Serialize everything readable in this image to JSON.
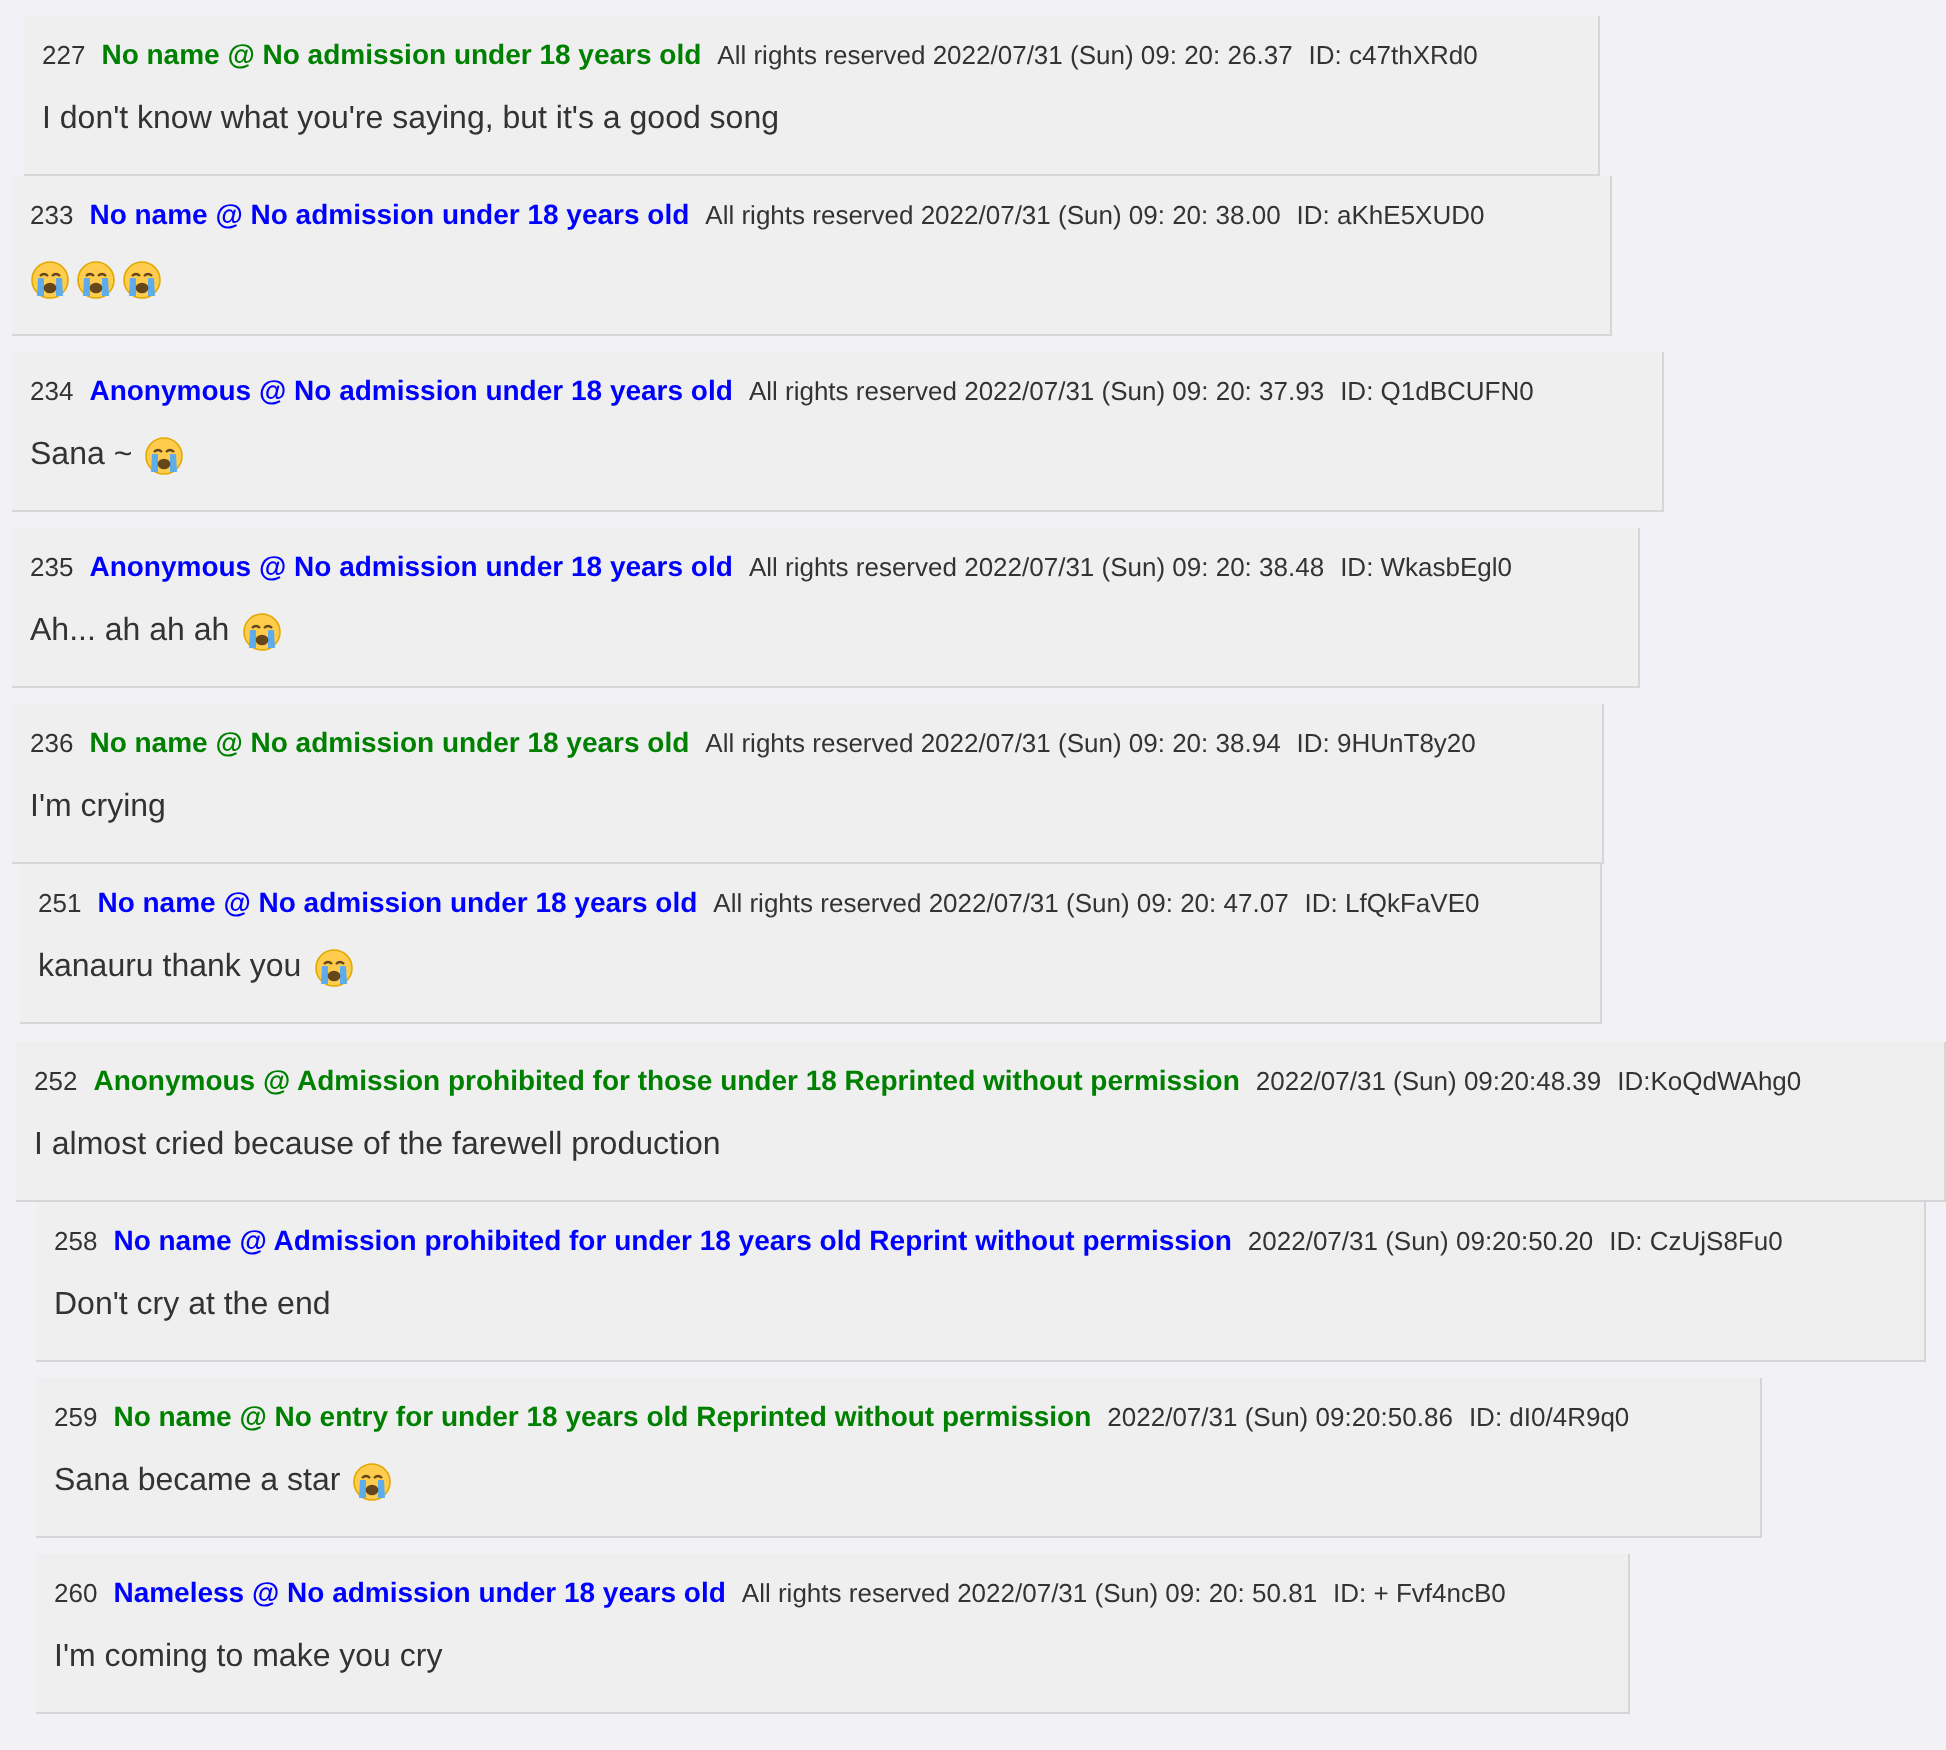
{
  "posts": [
    {
      "number": "227",
      "name": "No name @ No admission under 18 years old",
      "color": "#008000",
      "date": "All rights reserved 2022/07/31 (Sun) 09: 20: 26.37",
      "id": "ID: c47thXRd0",
      "body": "I don't know what you're saying, but it's a good song"
    },
    {
      "number": "233",
      "name": "No name @ No admission under 18 years old",
      "color": "#0000ff",
      "date": "All rights reserved 2022/07/31 (Sun) 09: 20: 38.00",
      "id": "ID: aKhE5XUD0",
      "emojis": [
        {
          "kind": "crying"
        },
        {
          "kind": "crying"
        },
        {
          "kind": "crying"
        }
      ]
    },
    {
      "number": "234",
      "name": "Anonymous @ No admission under 18 years old",
      "color": "#0000ff",
      "date": "All rights reserved 2022/07/31 (Sun) 09: 20: 37.93",
      "id": "ID: Q1dBCUFN0",
      "body": "Sana ~",
      "emojis": [
        {
          "kind": "crying"
        }
      ]
    },
    {
      "number": "235",
      "name": "Anonymous @ No admission under 18 years old",
      "color": "#0000ff",
      "date": "All rights reserved 2022/07/31 (Sun) 09: 20: 38.48",
      "id": "ID: WkasbEgl0",
      "body": "Ah... ah ah ah",
      "emojis": [
        {
          "kind": "crying"
        }
      ]
    },
    {
      "number": "236",
      "name": "No name @ No admission under 18 years old",
      "color": "#008000",
      "date": "All rights reserved 2022/07/31 (Sun) 09: 20: 38.94",
      "id": "ID: 9HUnT8y20",
      "body": "I'm crying"
    },
    {
      "number": "251",
      "name": "No name @ No admission under 18 years old",
      "color": "#0000ff",
      "date": "All rights reserved 2022/07/31 (Sun) 09: 20: 47.07",
      "id": "ID: LfQkFaVE0",
      "body": "kanauru thank you",
      "emojis": [
        {
          "kind": "crying"
        }
      ]
    },
    {
      "number": "252",
      "name": "Anonymous @ Admission prohibited for those under 18 Reprinted without permission",
      "color": "#008000",
      "date": "2022/07/31 (Sun) 09:20:48.39",
      "id": "ID:KoQdWAhg0",
      "body": "I almost cried because of the farewell production"
    },
    {
      "number": "258",
      "name": "No name @ Admission prohibited for under 18 years old Reprint without permission",
      "color": "#0000ff",
      "date": "2022/07/31 (Sun) 09:20:50.20",
      "id": "ID: CzUjS8Fu0",
      "body": "Don't cry at the end"
    },
    {
      "number": "259",
      "name": "No name @ No entry for under 18 years old Reprinted without permission",
      "color": "#008000",
      "date": "2022/07/31 (Sun) 09:20:50.86",
      "id": "ID: dI0/4R9q0",
      "body": "Sana became a star",
      "emojis": [
        {
          "kind": "crying"
        }
      ]
    },
    {
      "number": "260",
      "name": "Nameless @ No admission under 18 years old",
      "color": "#0000ff",
      "date": "All rights reserved 2022/07/31 (Sun) 09: 20: 50.81",
      "id": "ID: + Fvf4ncB0",
      "body": "I'm coming to make you cry"
    }
  ]
}
